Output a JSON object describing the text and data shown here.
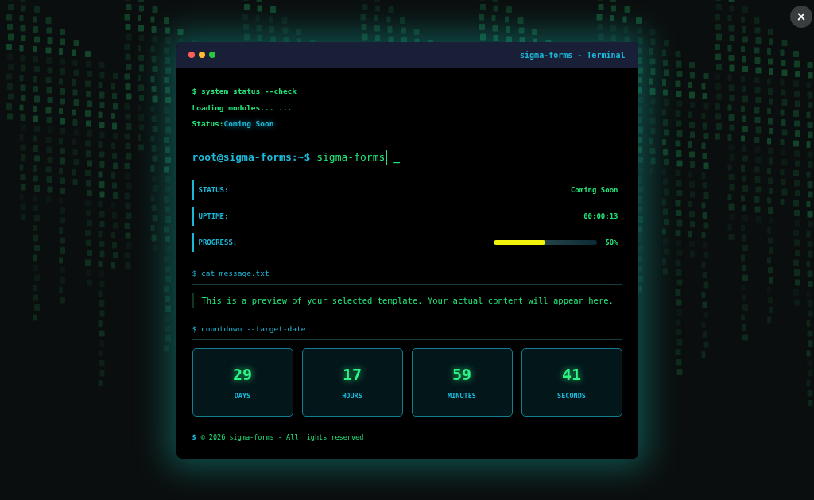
{
  "window": {
    "title": "sigma-forms - Terminal"
  },
  "boot_lines": [
    {
      "kind": "command",
      "text": "$ system_status --check"
    },
    {
      "kind": "output",
      "text": "Loading modules... ..."
    },
    {
      "kind": "status",
      "label": "Status:",
      "value": "Coming Soon"
    }
  ],
  "prompt": {
    "user": "root@sigma-forms:~$",
    "command": "sigma-forms",
    "cursor": "_"
  },
  "stats": [
    {
      "kind": "text",
      "label": "STATUS:",
      "value": "Coming Soon"
    },
    {
      "kind": "text",
      "label": "UPTIME:",
      "value": "00:00:13"
    },
    {
      "kind": "progress",
      "label": "PROGRESS:",
      "level": 0.5,
      "value": "50%"
    }
  ],
  "message": {
    "command": "$ cat message.txt",
    "text": "This is a preview of your selected template. Your actual content will appear here."
  },
  "countdown": {
    "command": "$ countdown --target-date",
    "units": [
      {
        "value": "29",
        "label": "DAYS"
      },
      {
        "value": "17",
        "label": "HOURS"
      },
      {
        "value": "59",
        "label": "MINUTES"
      },
      {
        "value": "41",
        "label": "SECONDS"
      }
    ]
  },
  "footer": {
    "prompt": "$",
    "text": "© 2026 sigma-forms - All rights reserved"
  },
  "close_button": {
    "label": "×"
  }
}
